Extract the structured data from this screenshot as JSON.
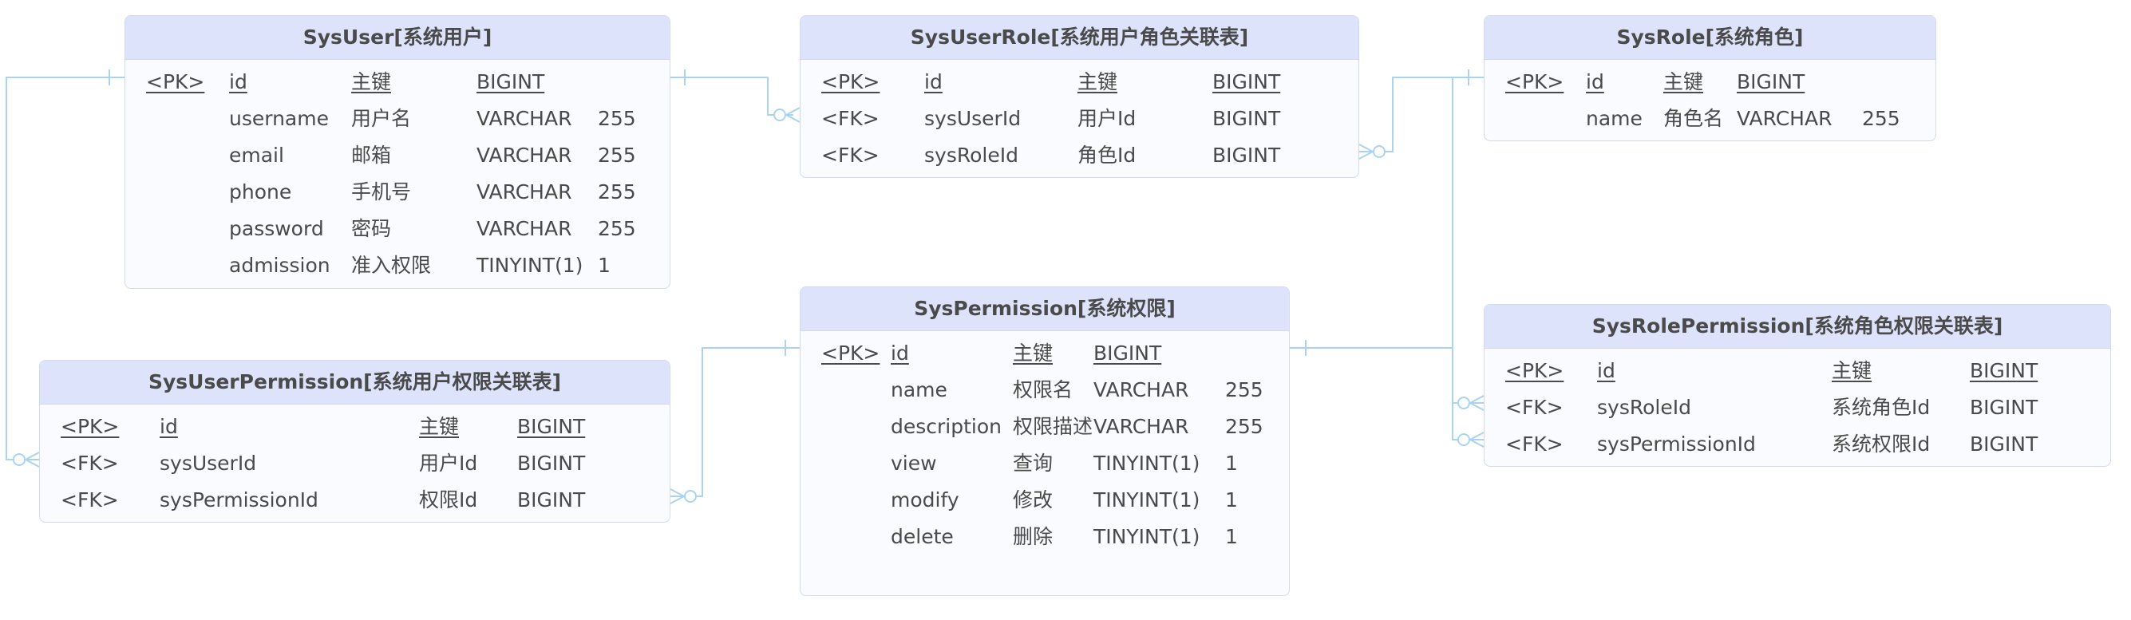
{
  "colors": {
    "header_bg": "#dce3fb",
    "body_bg": "#fafbfe",
    "border": "#d3daf0",
    "edge": "#a9d3f0",
    "text": "#4a4a4a"
  },
  "entities": {
    "sys_user": {
      "title": "SysUser[系统用户]",
      "rows": [
        {
          "key": "<PK>",
          "name": "id",
          "comment": "主键",
          "type": "BIGINT",
          "length": "",
          "pk": true
        },
        {
          "key": "",
          "name": "username",
          "comment": "用户名",
          "type": "VARCHAR",
          "length": "255",
          "pk": false
        },
        {
          "key": "",
          "name": "email",
          "comment": "邮箱",
          "type": "VARCHAR",
          "length": "255",
          "pk": false
        },
        {
          "key": "",
          "name": "phone",
          "comment": "手机号",
          "type": "VARCHAR",
          "length": "255",
          "pk": false
        },
        {
          "key": "",
          "name": "password",
          "comment": "密码",
          "type": "VARCHAR",
          "length": "255",
          "pk": false
        },
        {
          "key": "",
          "name": "admission",
          "comment": "准入权限",
          "type": "TINYINT(1)",
          "length": "1",
          "pk": false
        }
      ]
    },
    "sys_user_role": {
      "title": "SysUserRole[系统用户角色关联表]",
      "rows": [
        {
          "key": "<PK>",
          "name": "id",
          "comment": "主键",
          "type": "BIGINT",
          "length": "",
          "pk": true
        },
        {
          "key": "<FK>",
          "name": "sysUserId",
          "comment": "用户Id",
          "type": "BIGINT",
          "length": "",
          "pk": false
        },
        {
          "key": "<FK>",
          "name": "sysRoleId",
          "comment": "角色Id",
          "type": "BIGINT",
          "length": "",
          "pk": false
        }
      ]
    },
    "sys_role": {
      "title": "SysRole[系统角色]",
      "rows": [
        {
          "key": "<PK>",
          "name": "id",
          "comment": "主键",
          "type": "BIGINT",
          "length": "",
          "pk": true
        },
        {
          "key": "",
          "name": "name",
          "comment": "角色名",
          "type": "VARCHAR",
          "length": "255",
          "pk": false
        }
      ]
    },
    "sys_user_permission": {
      "title": "SysUserPermission[系统用户权限关联表]",
      "rows": [
        {
          "key": "<PK>",
          "name": "id",
          "comment": "主键",
          "type": "BIGINT",
          "length": "",
          "pk": true
        },
        {
          "key": "<FK>",
          "name": "sysUserId",
          "comment": "用户Id",
          "type": "BIGINT",
          "length": "",
          "pk": false
        },
        {
          "key": "<FK>",
          "name": "sysPermissionId",
          "comment": "权限Id",
          "type": "BIGINT",
          "length": "",
          "pk": false
        }
      ]
    },
    "sys_permission": {
      "title": "SysPermission[系统权限]",
      "rows": [
        {
          "key": "<PK>",
          "name": "id",
          "comment": "主键",
          "type": "BIGINT",
          "length": "",
          "pk": true
        },
        {
          "key": "",
          "name": "name",
          "comment": "权限名",
          "type": "VARCHAR",
          "length": "255",
          "pk": false
        },
        {
          "key": "",
          "name": "description",
          "comment": "权限描述",
          "type": "VARCHAR",
          "length": "255",
          "pk": false
        },
        {
          "key": "",
          "name": "view",
          "comment": "查询",
          "type": "TINYINT(1)",
          "length": "1",
          "pk": false
        },
        {
          "key": "",
          "name": "modify",
          "comment": "修改",
          "type": "TINYINT(1)",
          "length": "1",
          "pk": false
        },
        {
          "key": "",
          "name": "delete",
          "comment": "删除",
          "type": "TINYINT(1)",
          "length": "1",
          "pk": false
        }
      ]
    },
    "sys_role_permission": {
      "title": "SysRolePermission[系统角色权限关联表]",
      "rows": [
        {
          "key": "<PK>",
          "name": "id",
          "comment": "主键",
          "type": "BIGINT",
          "length": "",
          "pk": true
        },
        {
          "key": "<FK>",
          "name": "sysRoleId",
          "comment": "系统角色Id",
          "type": "BIGINT",
          "length": "",
          "pk": false
        },
        {
          "key": "<FK>",
          "name": "sysPermissionId",
          "comment": "系统权限Id",
          "type": "BIGINT",
          "length": "",
          "pk": false
        }
      ]
    }
  },
  "relationships": [
    {
      "from": "sys_user",
      "to": "sys_user_role",
      "from_end": "one",
      "to_end": "zero-or-many"
    },
    {
      "from": "sys_role",
      "to": "sys_user_role",
      "from_end": "one",
      "to_end": "zero-or-many"
    },
    {
      "from": "sys_user",
      "to": "sys_user_permission",
      "from_end": "one",
      "to_end": "zero-or-many"
    },
    {
      "from": "sys_permission",
      "to": "sys_user_permission",
      "from_end": "one",
      "to_end": "zero-or-many"
    },
    {
      "from": "sys_role",
      "to": "sys_role_permission",
      "from_end": "one",
      "to_end": "zero-or-many"
    },
    {
      "from": "sys_permission",
      "to": "sys_role_permission",
      "from_end": "one",
      "to_end": "zero-or-many"
    }
  ]
}
